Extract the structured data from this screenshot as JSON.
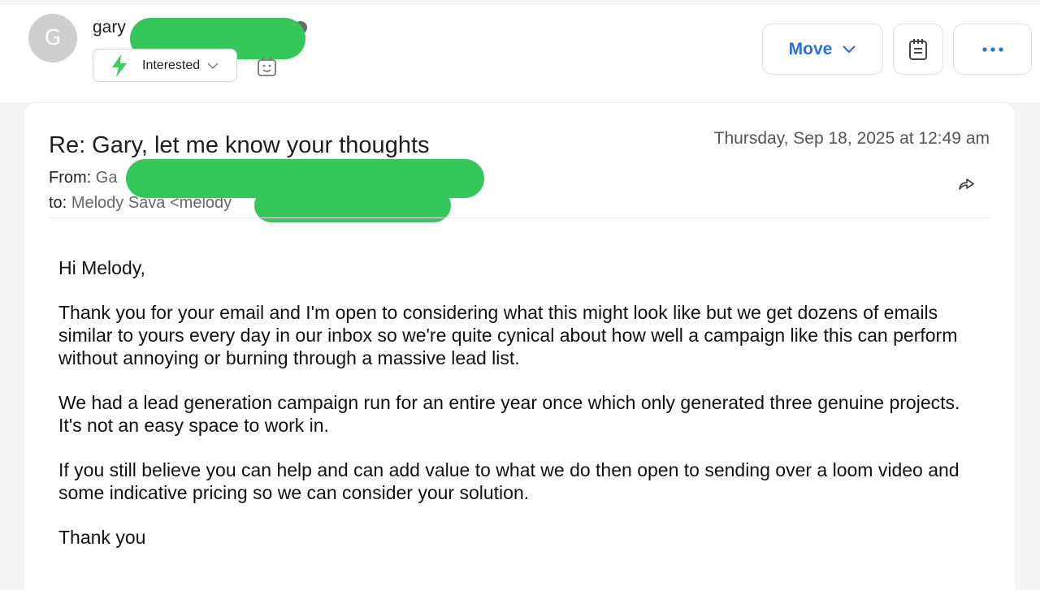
{
  "header": {
    "avatar_letter": "G",
    "sender_name": "gary",
    "status_label": "Interested",
    "move_label": "Move",
    "icons": [
      "lightning-icon",
      "chevron-down-icon",
      "bot-face-icon",
      "notepad-icon",
      "more-dots-icon"
    ]
  },
  "email": {
    "subject": "Re: Gary, let me know your thoughts",
    "date": "Thursday, Sep 18, 2025 at 12:49 am",
    "from_label": "From:",
    "from_value": "Ga",
    "to_label": "to:",
    "to_value": "Melody Sava <melody",
    "body": [
      "Hi Melody,",
      "Thank you for your email and I'm open to considering what this might look like but we get dozens of emails similar to yours every day in our inbox so we're quite cynical about how well a campaign like this can perform without annoying or burning through a massive lead list.",
      "We had a lead generation campaign run for an entire year once which only generated three genuine projects. It's not an easy space to work in.",
      "If you still believe you can help and can add value to what we do then open to sending over a loom video and some indicative pricing so we can consider your solution.",
      "Thank you"
    ]
  },
  "colors": {
    "accent": "#2e6fe0",
    "interested_green": "#3fcf5c",
    "redaction": "#34c759"
  }
}
